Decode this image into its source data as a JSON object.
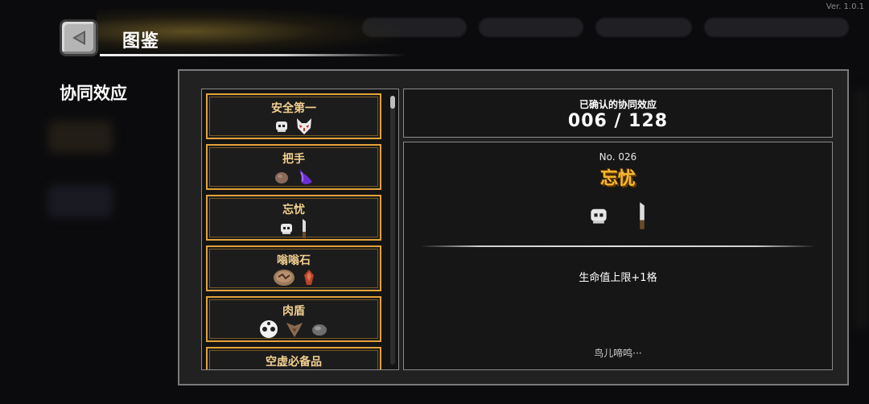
{
  "version": "Ver. 1.0.1",
  "header": {
    "title": "图鉴",
    "back_icon": "triangle-left-icon"
  },
  "section_title": "协同效应",
  "synergy_list": [
    {
      "name": "安全第一",
      "icons": [
        "skull-mask-icon",
        "fox-mask-icon"
      ]
    },
    {
      "name": "把手",
      "icons": [
        "rock-fist-icon",
        "purple-claw-icon"
      ]
    },
    {
      "name": "忘忧",
      "icons": [
        "skull-mask-icon",
        "knife-icon"
      ]
    },
    {
      "name": "嗡嗡石",
      "icons": [
        "cracked-stone-icon",
        "red-crystal-icon"
      ]
    },
    {
      "name": "肉盾",
      "icons": [
        "soccer-ball-icon",
        "bat-wing-icon",
        "gray-stone-icon"
      ]
    },
    {
      "name": "空虚必备品",
      "icons": []
    }
  ],
  "counter": {
    "label": "已确认的协同效应",
    "value": "006 / 128"
  },
  "detail": {
    "number": "No. 026",
    "name": "忘忧",
    "icons": [
      "skull-mask-icon",
      "knife-icon"
    ],
    "effect": "生命值上限+1格",
    "flavor": "鸟儿啼鸣···"
  },
  "colors": {
    "item_border": "#e3a23a",
    "item_name": "#f2d090",
    "detail_name": "#f5b832"
  }
}
